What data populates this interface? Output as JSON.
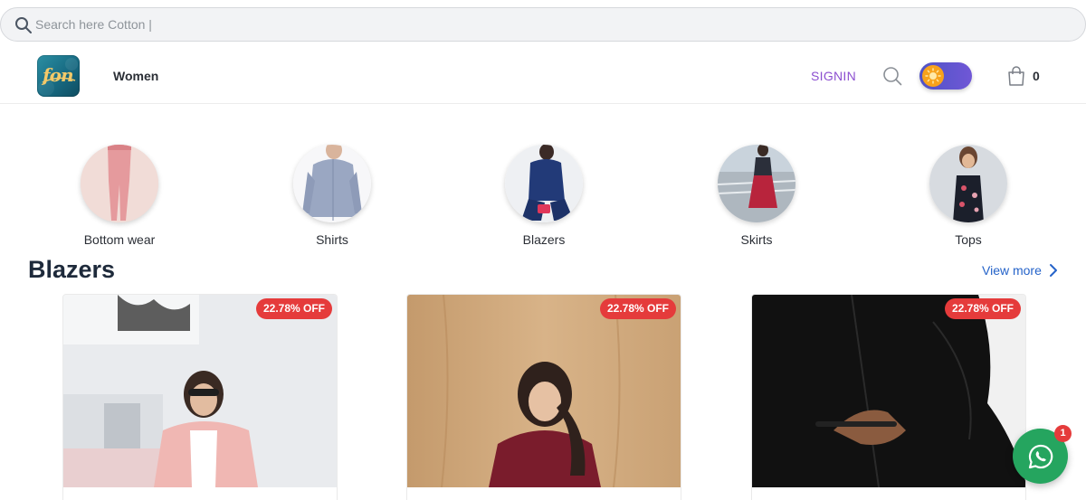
{
  "search": {
    "placeholder": "Search here Cotton |",
    "value": ""
  },
  "header": {
    "nav_label": "Women",
    "signin_label": "SIGNIN",
    "cart_count": "0",
    "logo_text": "fon"
  },
  "categories": [
    {
      "label": "Bottom wear"
    },
    {
      "label": "Shirts"
    },
    {
      "label": "Blazers"
    },
    {
      "label": "Skirts"
    },
    {
      "label": "Tops"
    }
  ],
  "section": {
    "title": "Blazers",
    "view_more": "View more"
  },
  "products": [
    {
      "discount": "22.78% OFF"
    },
    {
      "discount": "22.78% OFF"
    },
    {
      "discount": "22.78% OFF"
    }
  ],
  "whatsapp": {
    "badge": "1"
  },
  "colors": {
    "accent": "#8c4fd0",
    "link": "#2563c9",
    "discount": "#e53b3b",
    "whatsapp": "#25a55f",
    "toggle": "#5b55cf"
  }
}
